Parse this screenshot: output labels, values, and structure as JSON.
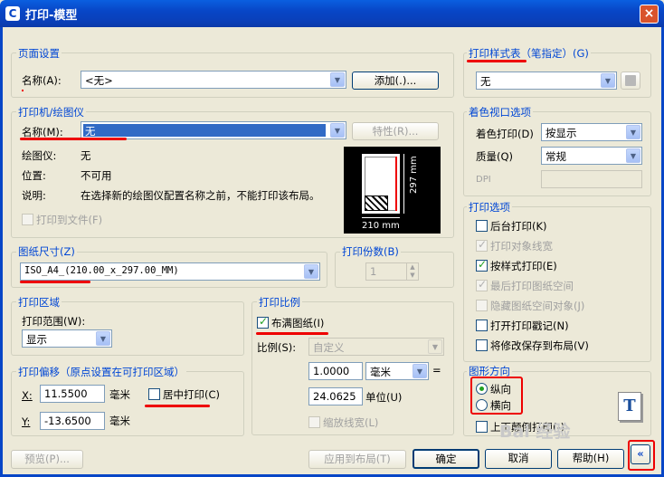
{
  "window": {
    "title": "打印-模型",
    "close_icon": "×"
  },
  "page_setup": {
    "group": "页面设置",
    "name_label": "名称(A):",
    "name_value": "<无>",
    "add_button": "添加(.)..."
  },
  "plotter": {
    "group": "打印机/绘图仪",
    "name_label": "名称(M):",
    "name_value": "无",
    "properties_button": "特性(R)...",
    "plotter_label": "绘图仪:",
    "plotter_value": "无",
    "location_label": "位置:",
    "location_value": "不可用",
    "desc_label": "说明:",
    "desc_value": "在选择新的绘图仪配置名称之前，不能打印该布局。",
    "print_to_file": "打印到文件(F)",
    "dim_w": "210 mm",
    "dim_h": "297 mm"
  },
  "paper_size": {
    "group": "图纸尺寸(Z)",
    "value": "ISO_A4_(210.00_x_297.00_MM)"
  },
  "copies": {
    "group": "打印份数(B)",
    "value": "1"
  },
  "plot_area": {
    "group": "打印区域",
    "range_label": "打印范围(W):",
    "range_value": "显示"
  },
  "plot_scale": {
    "group": "打印比例",
    "fit_label": "布满图纸(I)",
    "fit_checked": true,
    "scale_label": "比例(S):",
    "scale_value": "自定义",
    "value1": "1.0000",
    "unit1": "毫米",
    "equals": "=",
    "value2": "24.0625",
    "unit2_label": "单位(U)",
    "lineweights": "缩放线宽(L)"
  },
  "plot_offset": {
    "group": "打印偏移（原点设置在可打印区域）",
    "x_label": "X:",
    "x_value": "11.5500",
    "x_unit": "毫米",
    "center_label": "居中打印(C)",
    "center_checked": false,
    "y_label": "Y:",
    "y_value": "-13.6500",
    "y_unit": "毫米"
  },
  "style_table": {
    "group": "打印样式表（笔指定）(G)",
    "value": "无"
  },
  "shaded": {
    "group": "着色视口选项",
    "shade_label": "着色打印(D)",
    "shade_value": "按显示",
    "quality_label": "质量(Q)",
    "quality_value": "常规",
    "dpi_label": "DPI"
  },
  "options": {
    "group": "打印选项",
    "items": [
      {
        "label": "后台打印(K)",
        "checked": false,
        "disabled": false
      },
      {
        "label": "打印对象线宽",
        "checked": true,
        "disabled": true
      },
      {
        "label": "按样式打印(E)",
        "checked": true,
        "disabled": false
      },
      {
        "label": "最后打印图纸空间",
        "checked": true,
        "disabled": true
      },
      {
        "label": "隐藏图纸空间对象(J)",
        "checked": false,
        "disabled": true
      },
      {
        "label": "打开打印戳记(N)",
        "checked": false,
        "disabled": false
      },
      {
        "label": "将修改保存到布局(V)",
        "checked": false,
        "disabled": false
      }
    ]
  },
  "orientation": {
    "group": "图形方向",
    "portrait": "纵向",
    "landscape": "横向",
    "upside_down": "上下颠倒打印(-)",
    "selected": "portrait",
    "icon_letter": "T"
  },
  "footer": {
    "preview": "预览(P)...",
    "apply": "应用到布局(T)",
    "ok": "确定",
    "cancel": "取消",
    "help": "帮助(H)",
    "more": "«"
  },
  "watermark": "Bai 经验"
}
